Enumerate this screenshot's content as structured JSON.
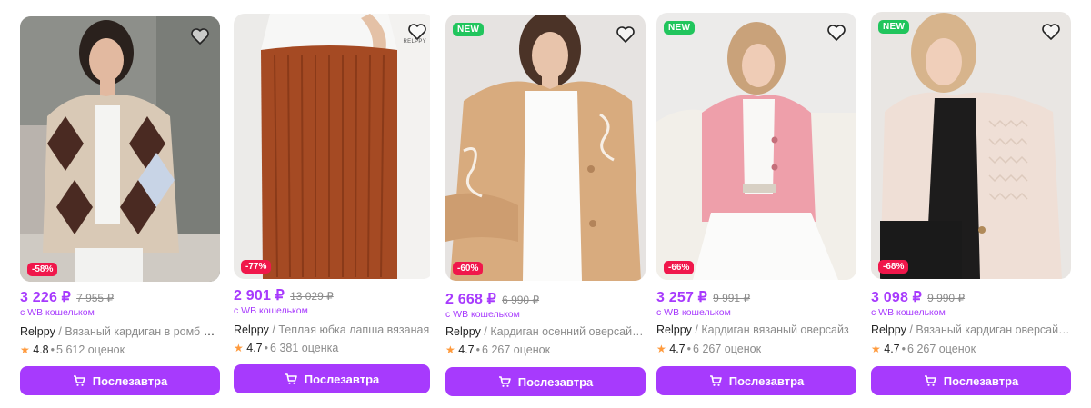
{
  "currency": "₽",
  "wallet_label": "с WB кошельком",
  "buy_label": "Послезавтра",
  "new_label": "NEW",
  "brand_mark": "RELPPY",
  "colors": {
    "accent": "#a73afd",
    "discount": "#f0174b",
    "new": "#21c55d",
    "star": "#ff9a3c"
  },
  "products": [
    {
      "price": "3 226 ₽",
      "old_price": "7 955 ₽",
      "discount": "-58%",
      "brand": "Relppy",
      "title": " / Вязаный кардиган в ромб у…",
      "rating": "4.8",
      "reviews": "5 612 оценок",
      "is_new": false
    },
    {
      "price": "2 901 ₽",
      "old_price": "13 029 ₽",
      "discount": "-77%",
      "brand": "Relppy",
      "title": " / Теплая юбка лапша вязаная",
      "rating": "4.7",
      "reviews": "6 381 оценка",
      "is_new": false
    },
    {
      "price": "2 668 ₽",
      "old_price": "6 990 ₽",
      "discount": "-60%",
      "brand": "Relppy",
      "title": " / Кардиган осенний оверсай…",
      "rating": "4.7",
      "reviews": "6 267 оценок",
      "is_new": true
    },
    {
      "price": "3 257 ₽",
      "old_price": "9 991 ₽",
      "discount": "-66%",
      "brand": "Relppy",
      "title": " / Кардиган вязаный оверсайз",
      "rating": "4.7",
      "reviews": "6 267 оценок",
      "is_new": true
    },
    {
      "price": "3 098 ₽",
      "old_price": "9 990 ₽",
      "discount": "-68%",
      "brand": "Relppy",
      "title": " / Вязаный кардиган оверсай…",
      "rating": "4.7",
      "reviews": "6 267 оценок",
      "is_new": true
    }
  ]
}
